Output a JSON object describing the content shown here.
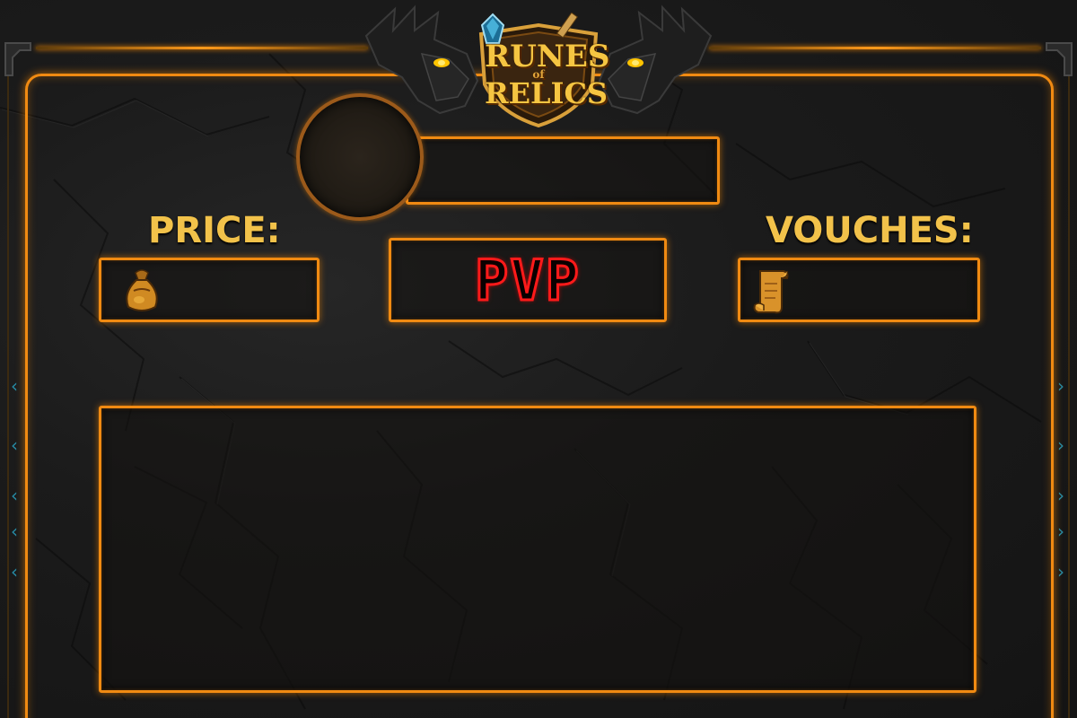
{
  "logo": {
    "line1": "RUNES",
    "line2": "RELICS",
    "connector": "of"
  },
  "labels": {
    "price": "PRICE:",
    "vouches": "VOUCHES:"
  },
  "mode": {
    "text": "PVP"
  },
  "fields": {
    "name": "",
    "price": "",
    "vouches": "",
    "description": ""
  },
  "colors": {
    "accent": "#f08a12",
    "label": "#f2c24a",
    "mode_outline": "#ff1a1a",
    "rune_glow": "#2aa8c8"
  },
  "icons": {
    "price": "gold-pouch-icon",
    "vouches": "scroll-icon"
  }
}
